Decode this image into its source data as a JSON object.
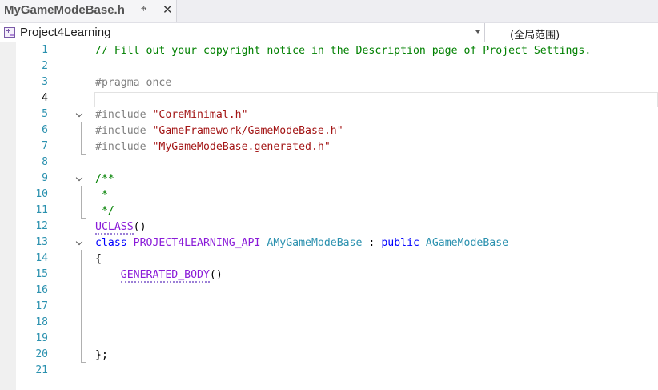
{
  "tab": {
    "title": "MyGameModeBase.h",
    "pin_icon": "pin-icon",
    "close_icon": "close-icon",
    "pin_glyph": "⌖",
    "close_glyph": "✕"
  },
  "navbar": {
    "project": "Project4Learning",
    "project_icon": "cpp-project-icon",
    "scope": "(全局范围)"
  },
  "editor": {
    "current_line": 4,
    "lines": [
      {
        "n": "1",
        "tokens": [
          {
            "t": "// Fill out your copyright notice in the Description page of Project Settings.",
            "c": "comment"
          }
        ]
      },
      {
        "n": "2",
        "tokens": []
      },
      {
        "n": "3",
        "tokens": [
          {
            "t": "#pragma once",
            "c": "pre"
          }
        ]
      },
      {
        "n": "4",
        "tokens": []
      },
      {
        "n": "5",
        "tokens": [
          {
            "t": "#include ",
            "c": "pre"
          },
          {
            "t": "\"CoreMinimal.h\"",
            "c": "str"
          }
        ]
      },
      {
        "n": "6",
        "tokens": [
          {
            "t": "#include ",
            "c": "pre"
          },
          {
            "t": "\"GameFramework/GameModeBase.h\"",
            "c": "str"
          }
        ]
      },
      {
        "n": "7",
        "tokens": [
          {
            "t": "#include ",
            "c": "pre"
          },
          {
            "t": "\"MyGameModeBase.generated.h\"",
            "c": "str"
          }
        ]
      },
      {
        "n": "8",
        "tokens": []
      },
      {
        "n": "9",
        "tokens": [
          {
            "t": "/**",
            "c": "comment"
          }
        ]
      },
      {
        "n": "10",
        "tokens": [
          {
            "t": " *",
            "c": "comment"
          }
        ]
      },
      {
        "n": "11",
        "tokens": [
          {
            "t": " */",
            "c": "comment"
          }
        ]
      },
      {
        "n": "12",
        "tokens": [
          {
            "t": "UCLASS",
            "c": "macro",
            "sq": true
          },
          {
            "t": "()",
            "c": "plain"
          }
        ]
      },
      {
        "n": "13",
        "tokens": [
          {
            "t": "class ",
            "c": "kw"
          },
          {
            "t": "PROJECT4LEARNING_API",
            "c": "macro"
          },
          {
            "t": " ",
            "c": "plain"
          },
          {
            "t": "AMyGameModeBase",
            "c": "type"
          },
          {
            "t": " : ",
            "c": "plain"
          },
          {
            "t": "public",
            "c": "kw"
          },
          {
            "t": " ",
            "c": "plain"
          },
          {
            "t": "AGameModeBase",
            "c": "type"
          }
        ]
      },
      {
        "n": "14",
        "tokens": [
          {
            "t": "{",
            "c": "plain"
          }
        ]
      },
      {
        "n": "15",
        "tokens": [
          {
            "t": "    ",
            "c": "plain"
          },
          {
            "t": "GENERATED_BODY",
            "c": "macro",
            "sq": true
          },
          {
            "t": "()",
            "c": "plain"
          }
        ]
      },
      {
        "n": "16",
        "tokens": []
      },
      {
        "n": "17",
        "tokens": []
      },
      {
        "n": "18",
        "tokens": []
      },
      {
        "n": "19",
        "tokens": []
      },
      {
        "n": "20",
        "tokens": [
          {
            "t": "};",
            "c": "plain"
          }
        ]
      },
      {
        "n": "21",
        "tokens": []
      }
    ]
  }
}
